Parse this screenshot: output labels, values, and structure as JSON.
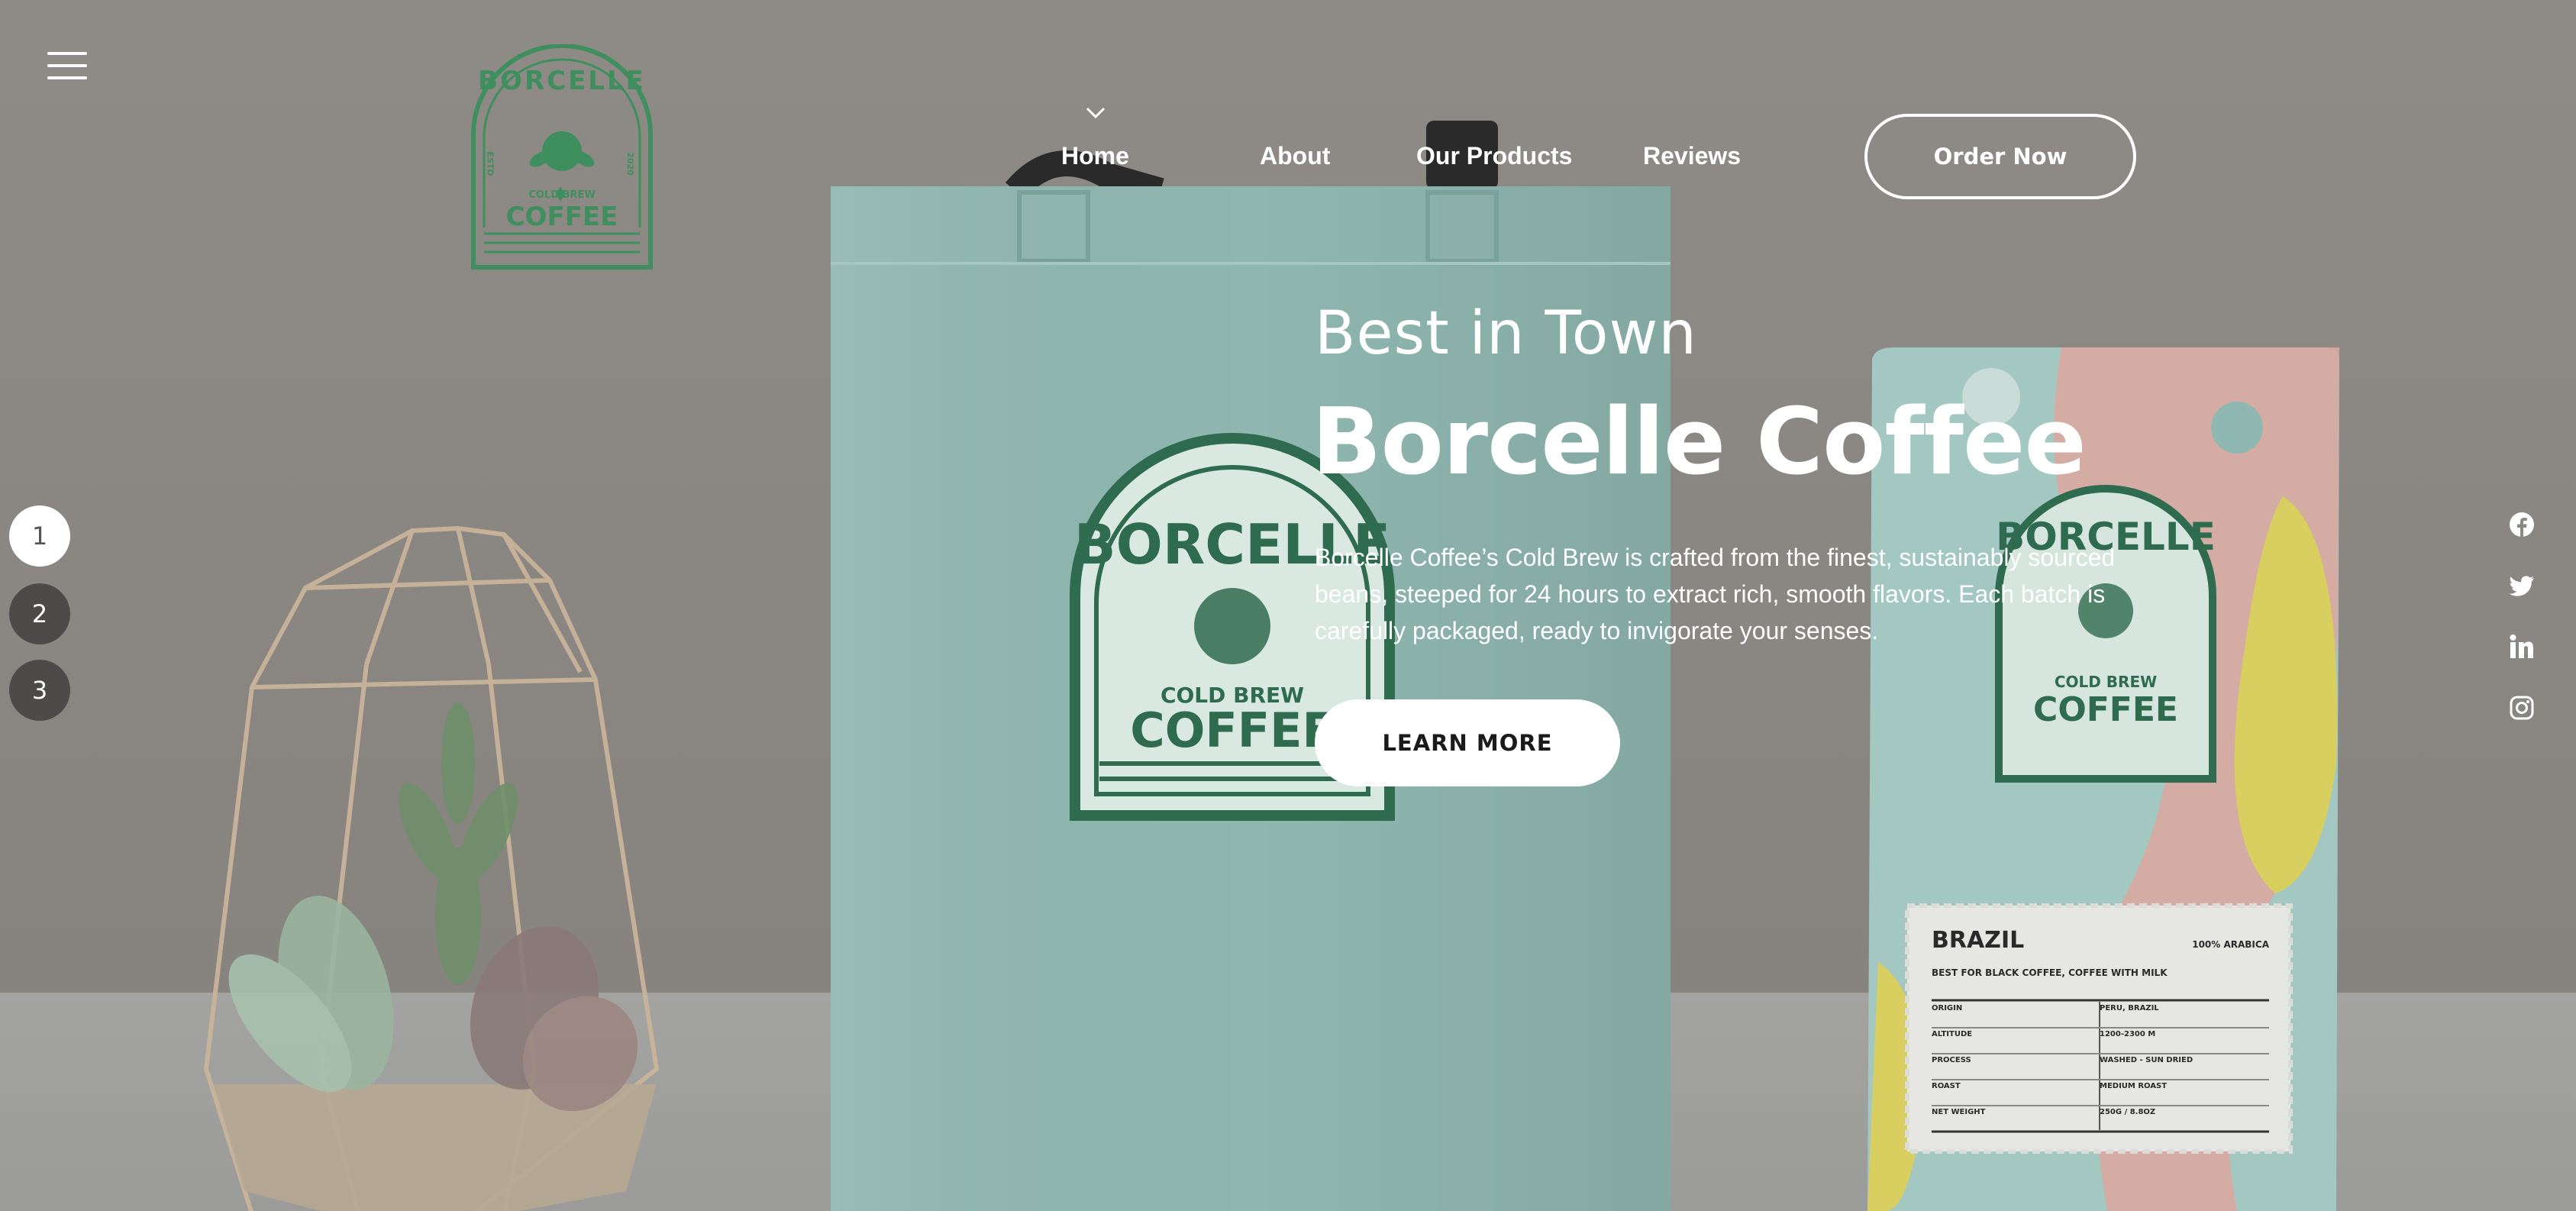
{
  "header": {
    "menu_icon": "hamburger-menu-icon",
    "logo": {
      "arc_text": "BORCELLE",
      "left_text": "ESTD",
      "right_text": "2020",
      "sub_text": "COLD BREW",
      "main_text": "COFFEE"
    },
    "nav": [
      {
        "label": "Home",
        "active": true
      },
      {
        "label": "About"
      },
      {
        "label": "Our Products"
      },
      {
        "label": "Reviews"
      }
    ],
    "order_button": "Order Now"
  },
  "hero": {
    "subtitle": "Best in Town",
    "title": "Borcelle Coffee",
    "description": "Borcelle Coffee’s Cold Brew is crafted from the finest, sustainably sourced beans, steeped for 24 hours to extract rich, smooth flavors. Each batch is carefully packaged, ready to invigorate your senses.",
    "cta_button": "LEARN MORE"
  },
  "slides": [
    "1",
    "2",
    "3"
  ],
  "active_slide": 1,
  "social_icons": [
    "facebook-icon",
    "twitter-icon",
    "linkedin-icon",
    "instagram-icon"
  ],
  "colors": {
    "brand_green": "#3f8f5e",
    "bag_teal": "#9cc3bd",
    "text": "#ffffff"
  },
  "product_label": {
    "name": "BRAZIL",
    "badge": "100% ARABICA",
    "tagline": "BEST FOR BLACK COFFEE, COFFEE WITH MILK",
    "rows": [
      {
        "key": "ORIGIN",
        "value": "PERU, BRAZIL"
      },
      {
        "key": "ALTITUDE",
        "value": "1200-2300 M"
      },
      {
        "key": "PROCESS",
        "value": "WASHED - SUN DRIED"
      },
      {
        "key": "ROAST",
        "value": "MEDIUM ROAST"
      },
      {
        "key": "NET WEIGHT",
        "value": "250G / 8.8OZ"
      }
    ]
  }
}
